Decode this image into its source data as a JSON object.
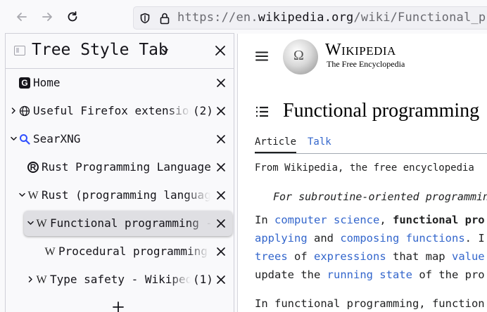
{
  "browser": {
    "url_prefix": "https://en.",
    "url_domain": "wikipedia.org",
    "url_path": "/wiki/Functional_pro"
  },
  "sidebar": {
    "title": "Tree Style Tab",
    "new_tab_symbol": "+",
    "tabs": [
      {
        "label": "Home",
        "favicon": "G",
        "count": ""
      },
      {
        "label": "Useful Firefox extensions",
        "favicon": "globe-icon",
        "count": "(2)"
      },
      {
        "label": "SearXNG",
        "favicon": "search-icon",
        "count": ""
      },
      {
        "label": "Rust Programming Language",
        "favicon": "R",
        "count": ""
      },
      {
        "label": "Rust (programming language)",
        "favicon": "W",
        "count": ""
      },
      {
        "label": "Functional programming - Wikipedia",
        "favicon": "W",
        "count": ""
      },
      {
        "label": "Procedural programming",
        "favicon": "W",
        "count": ""
      },
      {
        "label": "Type safety - Wikipedia",
        "favicon": "W",
        "count": "(1)"
      }
    ]
  },
  "wiki": {
    "name": "Wikipedia",
    "tagline": "The Free Encyclopedia",
    "title": "Functional programming",
    "tab_article": "Article",
    "tab_talk": "Talk",
    "from": "From Wikipedia, the free encyclopedia",
    "hatnote": "For subroutine-oriented programming",
    "p1": {
      "t1": "In ",
      "l1": "computer science",
      "t2": ", ",
      "b1": "functional pro",
      "l2": "applying",
      "t3": " and ",
      "l3": "composing",
      "t4": " ",
      "l4": "functions",
      "t5": ". I",
      "l5": "trees",
      "t6": " of ",
      "l6": "expressions",
      "t7": " that map ",
      "l7": "value",
      "t8": "update the ",
      "l8": "running state",
      "t9": " of the pro"
    },
    "p2": "In functional programming, function"
  }
}
